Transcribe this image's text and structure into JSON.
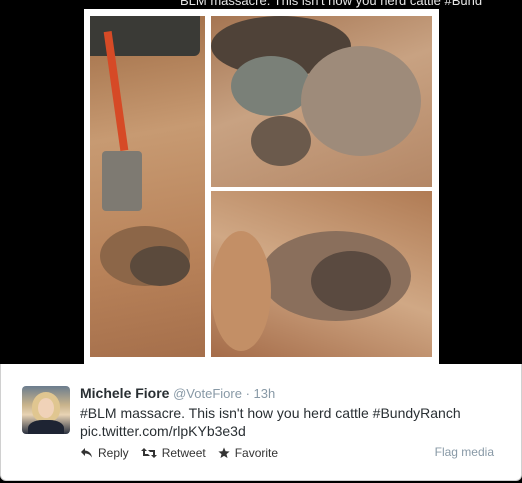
{
  "background_text": "BLM massacre. This isn't how you herd cattle #Bund",
  "tweet": {
    "name": "Michele Fiore",
    "handle": "@VoteFiore",
    "separator": "·",
    "time": "13h",
    "text_line1": "#BLM massacre. This isn't how you herd cattle #BundyRanch",
    "text_line2": "pic.twitter.com/rlpKYb3e3d",
    "actions": {
      "reply": "Reply",
      "retweet": "Retweet",
      "favorite": "Favorite"
    },
    "flag_media": "Flag media"
  },
  "colors": {
    "name": "#292f33",
    "muted": "#8899a6",
    "media_background": "#000000"
  }
}
